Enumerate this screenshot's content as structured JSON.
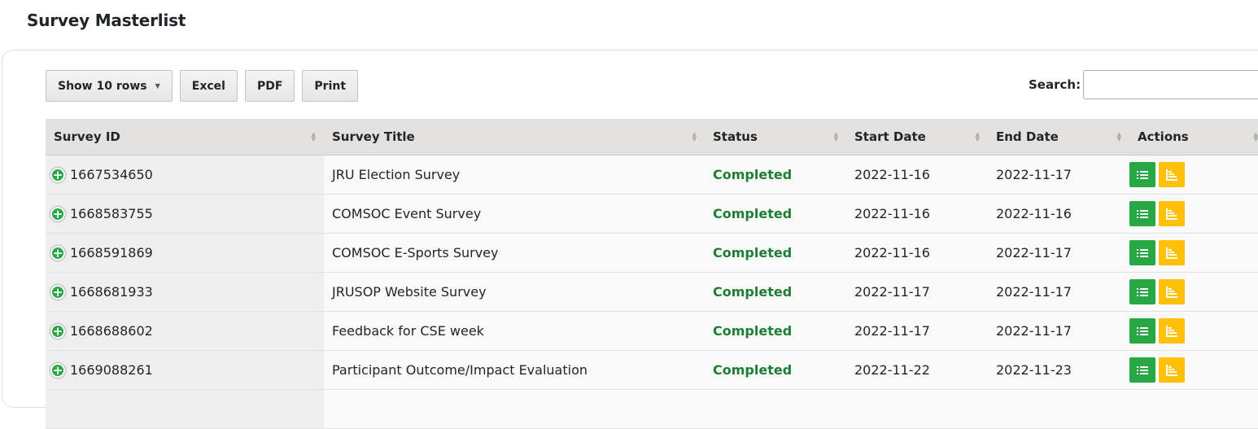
{
  "page": {
    "title": "Survey Masterlist"
  },
  "toolbar": {
    "show_rows_label": "Show 10 rows",
    "excel_label": "Excel",
    "pdf_label": "PDF",
    "print_label": "Print"
  },
  "search": {
    "label": "Search:",
    "value": ""
  },
  "table": {
    "headers": [
      "Survey ID",
      "Survey Title",
      "Status",
      "Start Date",
      "End Date",
      "Actions"
    ],
    "rows": [
      {
        "id": "1667534650",
        "title": "JRU Election Survey",
        "status": "Completed",
        "start": "2022-11-16",
        "end": "2022-11-17"
      },
      {
        "id": "1668583755",
        "title": "COMSOC Event Survey",
        "status": "Completed",
        "start": "2022-11-16",
        "end": "2022-11-16"
      },
      {
        "id": "1668591869",
        "title": "COMSOC E-Sports Survey",
        "status": "Completed",
        "start": "2022-11-16",
        "end": "2022-11-17"
      },
      {
        "id": "1668681933",
        "title": "JRUSOP Website Survey",
        "status": "Completed",
        "start": "2022-11-17",
        "end": "2022-11-17"
      },
      {
        "id": "1668688602",
        "title": "Feedback for CSE week",
        "status": "Completed",
        "start": "2022-11-17",
        "end": "2022-11-17"
      },
      {
        "id": "1669088261",
        "title": "Participant Outcome/Impact Evaluation",
        "status": "Completed",
        "start": "2022-11-22",
        "end": "2022-11-23"
      }
    ]
  },
  "colors": {
    "status_completed": "#1e7e34",
    "action_list": "#28a745",
    "action_report": "#ffc107",
    "header_bg": "#e3e2e1"
  },
  "icons": {
    "expand": "plus-circle-icon",
    "list": "list-icon",
    "report": "bar-chart-icon",
    "sort": "sort-icon"
  }
}
